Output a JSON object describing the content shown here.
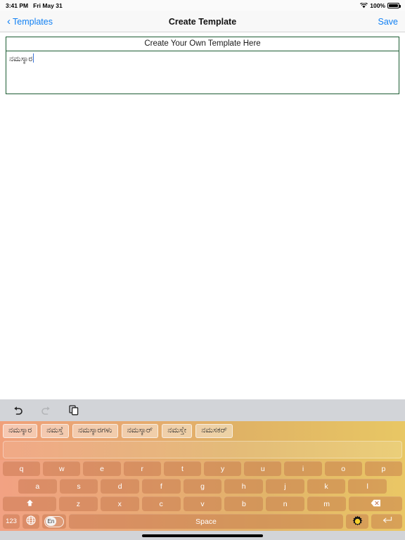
{
  "status_bar": {
    "time": "3:41 PM",
    "date": "Fri May 31",
    "battery_percent": "100%",
    "wifi_icon": "wifi-icon",
    "battery_icon": "battery-icon"
  },
  "nav_bar": {
    "back_label": "Templates",
    "back_chevron": "chevron-left-icon",
    "title": "Create Template",
    "save_label": "Save",
    "accent_color": "#1180f3"
  },
  "editor": {
    "header": "Create Your Own Template Here",
    "body_text": "ನಮಸ್ಕಾರ",
    "border_color": "#1c5c32"
  },
  "keyboard": {
    "toolbar": [
      {
        "name": "undo-icon",
        "label": "Undo",
        "enabled": true
      },
      {
        "name": "redo-icon",
        "label": "Redo",
        "enabled": false
      },
      {
        "name": "clipboard-icon",
        "label": "Clipboard",
        "enabled": true
      }
    ],
    "suggestions": [
      "ನಮಸ್ಕಾರ",
      "ನಮಸ್ತೆ",
      "ನಮಸ್ಕಾರಗಳು",
      "ನಮಸ್ಕಾರ್",
      "ನಮಸ್ತೇ",
      "ನಮಸಕರ್"
    ],
    "row1": [
      "q",
      "w",
      "e",
      "r",
      "t",
      "y",
      "u",
      "i",
      "o",
      "p"
    ],
    "row2": [
      "a",
      "s",
      "d",
      "f",
      "g",
      "h",
      "j",
      "k",
      "l"
    ],
    "row3": [
      "z",
      "x",
      "c",
      "v",
      "b",
      "n",
      "m"
    ],
    "shift_icon": "shift-icon",
    "backspace_icon": "backspace-icon",
    "numbers_label": "123",
    "globe_icon": "globe-icon",
    "language_toggle_label": "En",
    "space_label": "Space",
    "gear_icon": "gear-icon",
    "return_icon": "return-icon",
    "key_color": "#be6e46",
    "gradient_start": "#f2a283",
    "gradient_end": "#eac765"
  }
}
